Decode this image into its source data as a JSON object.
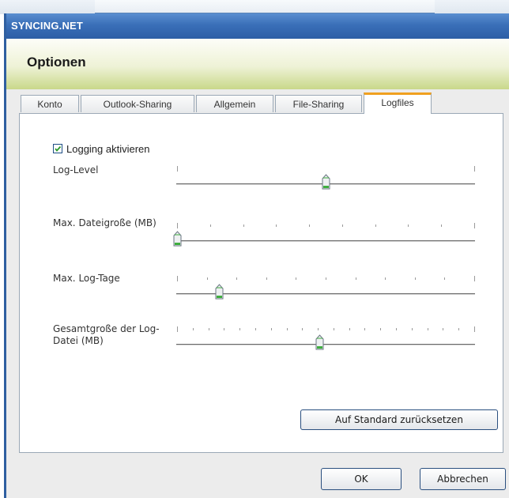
{
  "window": {
    "title": "SYNCING.NET"
  },
  "header": {
    "heading": "Optionen"
  },
  "tabs": [
    {
      "label": "Konto",
      "active": false
    },
    {
      "label": "Outlook-Sharing",
      "active": false
    },
    {
      "label": "Allgemein",
      "active": false
    },
    {
      "label": "File-Sharing",
      "active": false
    },
    {
      "label": "Logfiles",
      "active": true
    }
  ],
  "logging": {
    "label": "Logging aktivieren",
    "checked": true
  },
  "sliders": [
    {
      "label": "Log-Level",
      "value_fraction": 0.5,
      "ticks": 2
    },
    {
      "label": "Max. Dateigroße (MB)",
      "value_fraction": 0.0,
      "ticks": 10
    },
    {
      "label": "Max. Log-Tage",
      "value_fraction": 0.14,
      "ticks": 11
    },
    {
      "label": "Gesamtgroße der Log-Datei (MB)",
      "value_fraction": 0.48,
      "ticks": 20
    }
  ],
  "buttons": {
    "reset": "Auf Standard zurücksetzen",
    "ok": "OK",
    "cancel": "Abbrechen"
  },
  "colors": {
    "title_bar": "#3a6fb8",
    "active_tab_accent": "#f0a020",
    "thumb_green": "#3fae3f"
  }
}
